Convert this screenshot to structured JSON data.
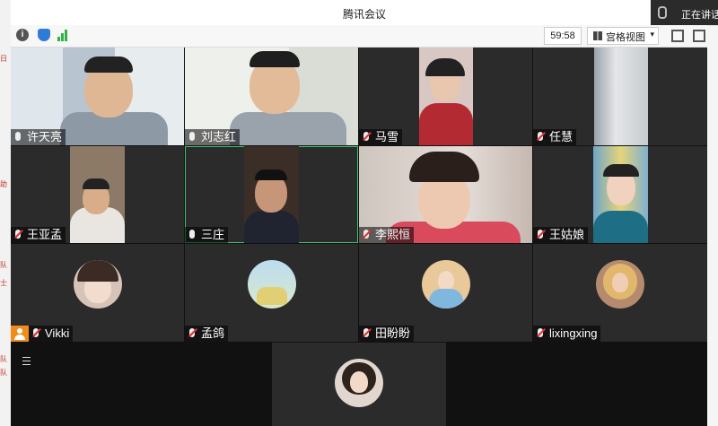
{
  "window": {
    "title": "腾讯会议",
    "speaking_status": "正在讲话:"
  },
  "toolbar": {
    "timer": "59:58",
    "view_mode": "宫格视图",
    "info_icon": "info-icon",
    "shield_icon": "shield-icon",
    "signal_icon": "signal-icon"
  },
  "participants": [
    {
      "name": "许天亮",
      "mic": "on"
    },
    {
      "name": "刘志红",
      "mic": "on"
    },
    {
      "name": "马雪",
      "mic": "muted"
    },
    {
      "name": "任慧",
      "mic": "muted"
    },
    {
      "name": "王亚孟",
      "mic": "muted"
    },
    {
      "name": "三庄",
      "mic": "on"
    },
    {
      "name": "李熙恒",
      "mic": "muted"
    },
    {
      "name": "王姑娘",
      "mic": "muted"
    },
    {
      "name": "Vikki",
      "mic": "muted"
    },
    {
      "name": "孟鸽",
      "mic": "muted"
    },
    {
      "name": "田盼盼",
      "mic": "muted"
    },
    {
      "name": "lixingxing",
      "mic": "muted"
    }
  ],
  "colors": {
    "active_border": "#3cc46b",
    "muted": "#e03131",
    "tile_bg": "#2b2b2b"
  }
}
